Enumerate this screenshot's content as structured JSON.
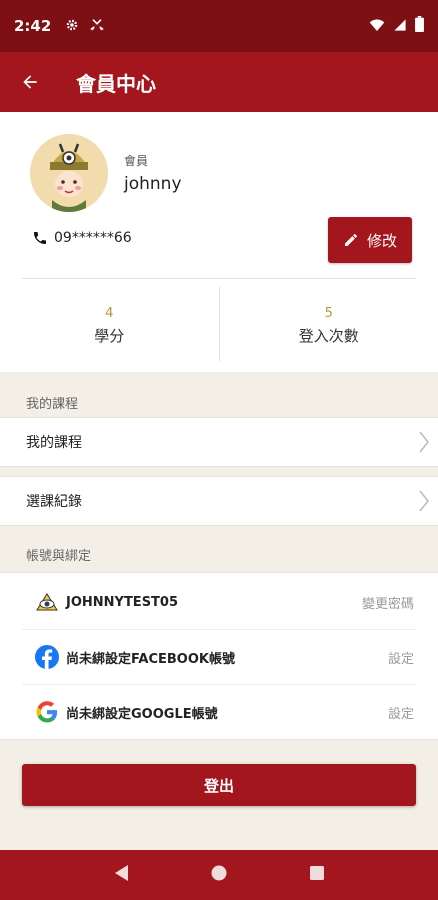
{
  "status_bar": {
    "time": "2:42"
  },
  "app_bar": {
    "title": "會員中心"
  },
  "profile": {
    "member_label": "會員",
    "name": "johnny",
    "phone": "09******66",
    "edit_label": "修改",
    "stats": [
      {
        "value": "4",
        "label": "學分"
      },
      {
        "value": "5",
        "label": "登入次數"
      }
    ]
  },
  "courses_section": {
    "header": "我的課程",
    "items": [
      {
        "label": "我的課程"
      },
      {
        "label": "選課紀錄"
      }
    ]
  },
  "account_section": {
    "header": "帳號與綁定",
    "items": [
      {
        "label": "JOHNNYTEST05",
        "action": "變更密碼",
        "icon": "app-logo-icon"
      },
      {
        "label": "尚未綁設定FACEBOOK帳號",
        "action": "設定",
        "icon": "facebook-icon"
      },
      {
        "label": "尚未綁設定GOOGLE帳號",
        "action": "設定",
        "icon": "google-icon"
      }
    ]
  },
  "logout_label": "登出",
  "colors": {
    "primary": "#a3161d",
    "status_bar": "#7e0f14",
    "background": "#f3efe6",
    "accent_number": "#b09a3e"
  }
}
